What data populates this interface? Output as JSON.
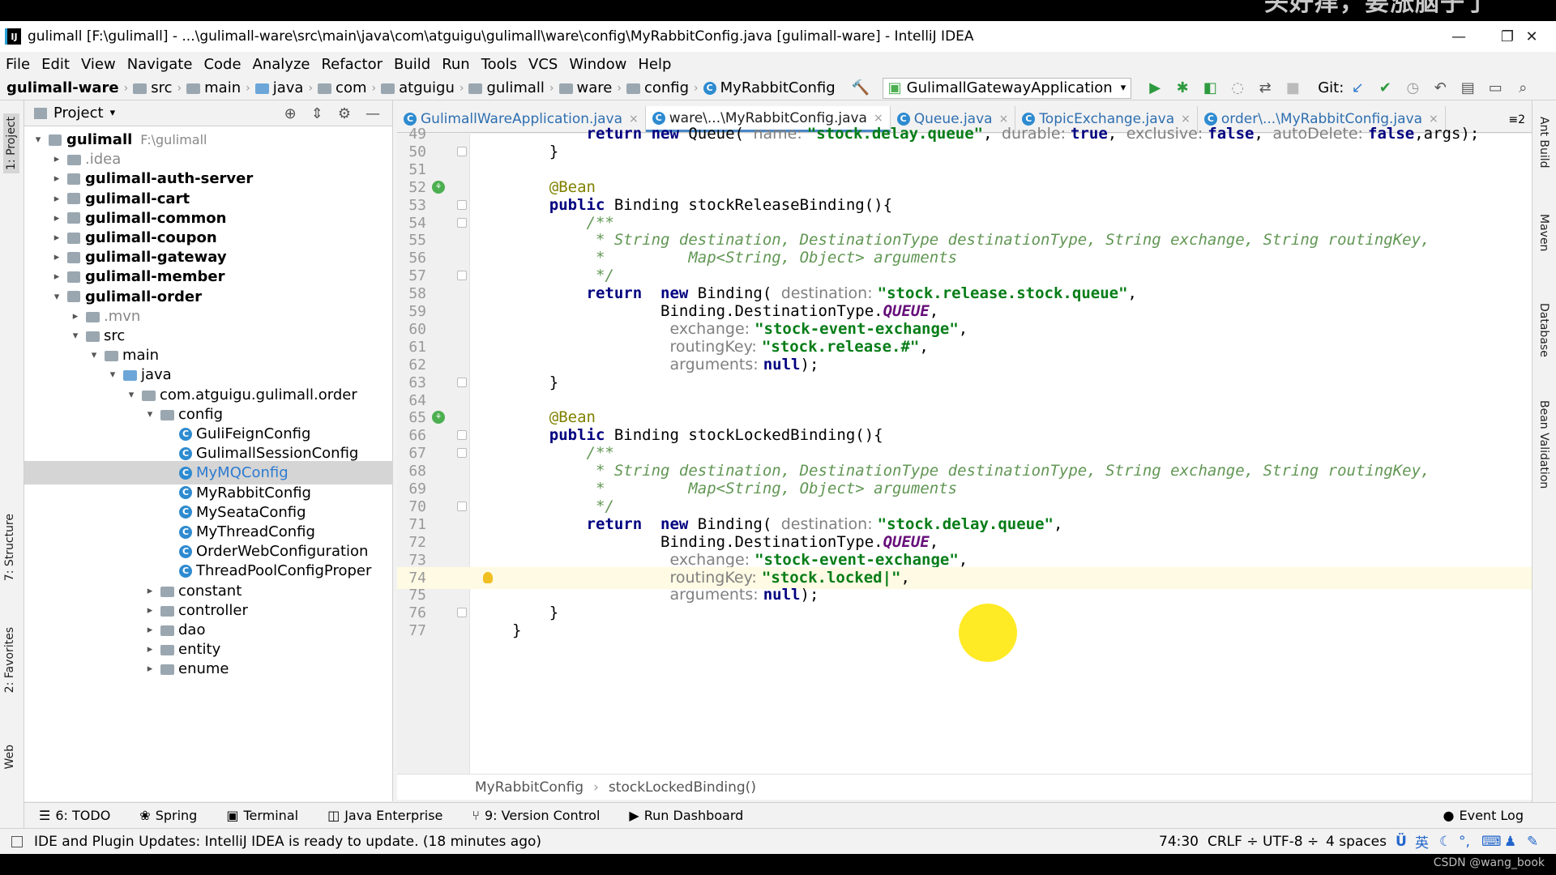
{
  "window": {
    "title": "gulimall [F:\\gulimall] - ...\\gulimall-ware\\src\\main\\java\\com\\atguigu\\gulimall\\ware\\config\\MyRabbitConfig.java [gulimall-ware] - IntelliJ IDEA",
    "watermark": "头好痒，要涨脑子了",
    "logo": "IJ"
  },
  "menu": [
    "File",
    "Edit",
    "View",
    "Navigate",
    "Code",
    "Analyze",
    "Refactor",
    "Build",
    "Run",
    "Tools",
    "VCS",
    "Window",
    "Help"
  ],
  "nav": {
    "crumbs": [
      "gulimall-ware",
      "src",
      "main",
      "java",
      "com",
      "atguigu",
      "gulimall",
      "ware",
      "config",
      "MyRabbitConfig"
    ],
    "run_config": "GulimallGatewayApplication",
    "git_label": "Git:"
  },
  "left_strip": {
    "project": "1: Project",
    "structure": "7: Structure",
    "favorites": "2: Favorites",
    "web": "Web"
  },
  "right_strip": {
    "ant": "Ant Build",
    "maven": "Maven",
    "database": "Database",
    "bean": "Bean Validation"
  },
  "project": {
    "title": "Project",
    "root_name": "gulimall",
    "root_path": "F:\\gulimall",
    "items": [
      {
        "label": "gulimall",
        "extra": "F:\\gulimall",
        "depth": 0,
        "arrow": "▾",
        "kind": "module",
        "bold": true
      },
      {
        "label": ".idea",
        "depth": 1,
        "arrow": "▸",
        "kind": "folder",
        "gray": true
      },
      {
        "label": "gulimall-auth-server",
        "depth": 1,
        "arrow": "▸",
        "kind": "module",
        "bold": true
      },
      {
        "label": "gulimall-cart",
        "depth": 1,
        "arrow": "▸",
        "kind": "module",
        "bold": true
      },
      {
        "label": "gulimall-common",
        "depth": 1,
        "arrow": "▸",
        "kind": "module",
        "bold": true
      },
      {
        "label": "gulimall-coupon",
        "depth": 1,
        "arrow": "▸",
        "kind": "module",
        "bold": true
      },
      {
        "label": "gulimall-gateway",
        "depth": 1,
        "arrow": "▸",
        "kind": "module",
        "bold": true
      },
      {
        "label": "gulimall-member",
        "depth": 1,
        "arrow": "▸",
        "kind": "module",
        "bold": true
      },
      {
        "label": "gulimall-order",
        "depth": 1,
        "arrow": "▾",
        "kind": "module",
        "bold": true
      },
      {
        "label": ".mvn",
        "depth": 2,
        "arrow": "▸",
        "kind": "folder",
        "gray": true
      },
      {
        "label": "src",
        "depth": 2,
        "arrow": "▾",
        "kind": "folder"
      },
      {
        "label": "main",
        "depth": 3,
        "arrow": "▾",
        "kind": "folder"
      },
      {
        "label": "java",
        "depth": 4,
        "arrow": "▾",
        "kind": "folder-blue"
      },
      {
        "label": "com.atguigu.gulimall.order",
        "depth": 5,
        "arrow": "▾",
        "kind": "folder"
      },
      {
        "label": "config",
        "depth": 6,
        "arrow": "▾",
        "kind": "folder"
      },
      {
        "label": "GuliFeignConfig",
        "depth": 7,
        "arrow": "",
        "kind": "class"
      },
      {
        "label": "GulimallSessionConfig",
        "depth": 7,
        "arrow": "",
        "kind": "class"
      },
      {
        "label": "MyMQConfig",
        "depth": 7,
        "arrow": "",
        "kind": "class",
        "selected": true
      },
      {
        "label": "MyRabbitConfig",
        "depth": 7,
        "arrow": "",
        "kind": "class"
      },
      {
        "label": "MySeataConfig",
        "depth": 7,
        "arrow": "",
        "kind": "class"
      },
      {
        "label": "MyThreadConfig",
        "depth": 7,
        "arrow": "",
        "kind": "class"
      },
      {
        "label": "OrderWebConfiguration",
        "depth": 7,
        "arrow": "",
        "kind": "class"
      },
      {
        "label": "ThreadPoolConfigProper",
        "depth": 7,
        "arrow": "",
        "kind": "class"
      },
      {
        "label": "constant",
        "depth": 6,
        "arrow": "▸",
        "kind": "folder"
      },
      {
        "label": "controller",
        "depth": 6,
        "arrow": "▸",
        "kind": "folder"
      },
      {
        "label": "dao",
        "depth": 6,
        "arrow": "▸",
        "kind": "folder"
      },
      {
        "label": "entity",
        "depth": 6,
        "arrow": "▸",
        "kind": "folder"
      },
      {
        "label": "enume",
        "depth": 6,
        "arrow": "▸",
        "kind": "folder"
      }
    ]
  },
  "tabs": [
    {
      "label": "GulimallWareApplication.java",
      "active": false,
      "icon": "C"
    },
    {
      "label": "ware\\...\\MyRabbitConfig.java",
      "active": true,
      "icon": "C"
    },
    {
      "label": "Queue.java",
      "active": false,
      "icon": "C"
    },
    {
      "label": "TopicExchange.java",
      "active": false,
      "icon": "C"
    },
    {
      "label": "order\\...\\MyRabbitConfig.java",
      "active": false,
      "icon": "C"
    }
  ],
  "tab_overflow": "≡2",
  "code_lines": [
    {
      "n": "49",
      "tokens": [
        [
          "kw",
          "return new "
        ],
        [
          "",
          "Queue( "
        ],
        [
          "hint",
          "name: "
        ],
        [
          "str",
          "\"stock.delay.queue\""
        ],
        [
          "",
          ", "
        ],
        [
          "hint",
          "durable: "
        ],
        [
          "kw",
          "true"
        ],
        [
          "",
          ", "
        ],
        [
          "hint",
          "exclusive: "
        ],
        [
          "kw",
          "false"
        ],
        [
          "",
          ", "
        ],
        [
          "hint",
          "autoDelete: "
        ],
        [
          "kw",
          "false"
        ],
        [
          "",
          ",args);"
        ]
      ],
      "indent": "        "
    },
    {
      "n": "50",
      "tokens": [
        [
          "",
          "}"
        ]
      ],
      "indent": "    "
    },
    {
      "n": "51",
      "tokens": [],
      "indent": ""
    },
    {
      "n": "52",
      "tokens": [
        [
          "ann",
          "@Bean"
        ]
      ],
      "indent": "    "
    },
    {
      "n": "53",
      "tokens": [
        [
          "kw",
          "public "
        ],
        [
          "",
          "Binding stockReleaseBinding(){"
        ]
      ],
      "indent": "    "
    },
    {
      "n": "54",
      "tokens": [
        [
          "cmt",
          "/**"
        ]
      ],
      "indent": "        "
    },
    {
      "n": "55",
      "tokens": [
        [
          "cmt",
          " * String destination, DestinationType destinationType, String exchange, String routingKey,"
        ]
      ],
      "indent": "        "
    },
    {
      "n": "56",
      "tokens": [
        [
          "cmt",
          " *         Map<String, Object> arguments"
        ]
      ],
      "indent": "        "
    },
    {
      "n": "57",
      "tokens": [
        [
          "cmt",
          " */"
        ]
      ],
      "indent": "        "
    },
    {
      "n": "58",
      "tokens": [
        [
          "kw",
          "return  new "
        ],
        [
          "",
          "Binding( "
        ],
        [
          "hint",
          "destination: "
        ],
        [
          "str",
          "\"stock.release.stock.queue\""
        ],
        [
          "",
          ","
        ]
      ],
      "indent": "        "
    },
    {
      "n": "59",
      "tokens": [
        [
          "",
          "Binding.DestinationType."
        ],
        [
          "enumc",
          "QUEUE"
        ],
        [
          "",
          ","
        ]
      ],
      "indent": "                "
    },
    {
      "n": "60",
      "tokens": [
        [
          "hint",
          "exchange: "
        ],
        [
          "str",
          "\"stock-event-exchange\""
        ],
        [
          "",
          ","
        ]
      ],
      "indent": "                 "
    },
    {
      "n": "61",
      "tokens": [
        [
          "hint",
          "routingKey: "
        ],
        [
          "str",
          "\"stock.release.#\""
        ],
        [
          "",
          ","
        ]
      ],
      "indent": "                 "
    },
    {
      "n": "62",
      "tokens": [
        [
          "hint",
          "arguments: "
        ],
        [
          "kw",
          "null"
        ],
        [
          "",
          ");"
        ]
      ],
      "indent": "                 "
    },
    {
      "n": "63",
      "tokens": [
        [
          "",
          "}"
        ]
      ],
      "indent": "    "
    },
    {
      "n": "64",
      "tokens": [],
      "indent": ""
    },
    {
      "n": "65",
      "tokens": [
        [
          "ann",
          "@Bean"
        ]
      ],
      "indent": "    "
    },
    {
      "n": "66",
      "tokens": [
        [
          "kw",
          "public "
        ],
        [
          "",
          "Binding stockLockedBinding(){"
        ]
      ],
      "indent": "    "
    },
    {
      "n": "67",
      "tokens": [
        [
          "cmt",
          "/**"
        ]
      ],
      "indent": "        "
    },
    {
      "n": "68",
      "tokens": [
        [
          "cmt",
          " * String destination, DestinationType destinationType, String exchange, String routingKey,"
        ]
      ],
      "indent": "        "
    },
    {
      "n": "69",
      "tokens": [
        [
          "cmt",
          " *         Map<String, Object> arguments"
        ]
      ],
      "indent": "        "
    },
    {
      "n": "70",
      "tokens": [
        [
          "cmt",
          " */"
        ]
      ],
      "indent": "        "
    },
    {
      "n": "71",
      "tokens": [
        [
          "kw",
          "return  new "
        ],
        [
          "",
          "Binding( "
        ],
        [
          "hint",
          "destination: "
        ],
        [
          "str",
          "\"stock.delay.queue\""
        ],
        [
          "",
          ","
        ]
      ],
      "indent": "        "
    },
    {
      "n": "72",
      "tokens": [
        [
          "",
          "Binding.DestinationType."
        ],
        [
          "enumc",
          "QUEUE"
        ],
        [
          "",
          ","
        ]
      ],
      "indent": "                "
    },
    {
      "n": "73",
      "tokens": [
        [
          "hint",
          "exchange: "
        ],
        [
          "str",
          "\"stock-event-exchange\""
        ],
        [
          "",
          ","
        ]
      ],
      "indent": "                 "
    },
    {
      "n": "74",
      "tokens": [
        [
          "hint",
          "routingKey: "
        ],
        [
          "str",
          "\"stock.locked|\""
        ],
        [
          "",
          ","
        ]
      ],
      "indent": "                 ",
      "caret": true
    },
    {
      "n": "75",
      "tokens": [
        [
          "hint",
          "arguments: "
        ],
        [
          "kw",
          "null"
        ],
        [
          "",
          ");"
        ]
      ],
      "indent": "                 "
    },
    {
      "n": "76",
      "tokens": [
        [
          "",
          "}"
        ]
      ],
      "indent": "    "
    },
    {
      "n": "77",
      "tokens": [
        [
          "",
          "}"
        ]
      ],
      "indent": ""
    }
  ],
  "editor_breadcrumb": [
    "MyRabbitConfig",
    "stockLockedBinding()"
  ],
  "tool_windows": [
    "6: TODO",
    "Spring",
    "Terminal",
    "Java Enterprise",
    "9: Version Control",
    "Run Dashboard"
  ],
  "event_log": "Event Log",
  "status": {
    "message": "IDE and Plugin Updates: IntelliJ IDEA is ready to update. (18 minutes ago)",
    "position": "74:30",
    "line_sep": "CRLF ÷",
    "encoding": "UTF-8 ÷",
    "indent": "4 spaces",
    "ime": "英"
  },
  "footer_credit": "CSDN @wang_book",
  "colors": {
    "accent": "#4a88c7",
    "keyword": "#000080",
    "string": "#067d17",
    "annotation": "#808000",
    "comment": "#629755"
  }
}
